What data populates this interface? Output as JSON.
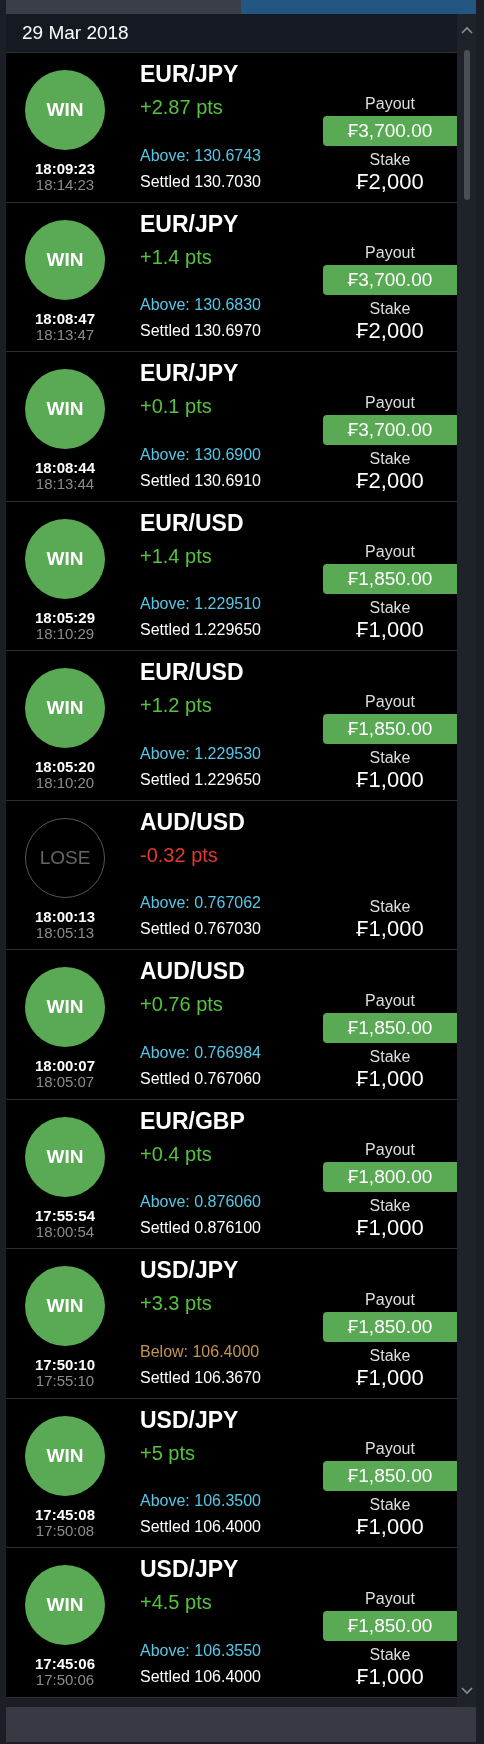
{
  "tabs": [
    {
      "selected": false
    },
    {
      "selected": true
    }
  ],
  "date_header": "29 Mar 2018",
  "trades": [
    {
      "kind": "win",
      "result_label": "WIN",
      "pair": "EUR/JPY",
      "points": "+2.87 pts",
      "below": false,
      "strike": "Above: 130.6743",
      "settled": "Settled 130.7030",
      "open_time": "18:09:23",
      "close_time": "18:14:23",
      "payout_label": "Payout",
      "payout": "₣3,700.00",
      "stake_label": "Stake",
      "stake": "₣2,000"
    },
    {
      "kind": "win",
      "result_label": "WIN",
      "pair": "EUR/JPY",
      "points": "+1.4 pts",
      "below": false,
      "strike": "Above: 130.6830",
      "settled": "Settled 130.6970",
      "open_time": "18:08:47",
      "close_time": "18:13:47",
      "payout_label": "Payout",
      "payout": "₣3,700.00",
      "stake_label": "Stake",
      "stake": "₣2,000"
    },
    {
      "kind": "win",
      "result_label": "WIN",
      "pair": "EUR/JPY",
      "points": "+0.1 pts",
      "below": false,
      "strike": "Above: 130.6900",
      "settled": "Settled 130.6910",
      "open_time": "18:08:44",
      "close_time": "18:13:44",
      "payout_label": "Payout",
      "payout": "₣3,700.00",
      "stake_label": "Stake",
      "stake": "₣2,000"
    },
    {
      "kind": "win",
      "result_label": "WIN",
      "pair": "EUR/USD",
      "points": "+1.4 pts",
      "below": false,
      "strike": "Above: 1.229510",
      "settled": "Settled 1.229650",
      "open_time": "18:05:29",
      "close_time": "18:10:29",
      "payout_label": "Payout",
      "payout": "₣1,850.00",
      "stake_label": "Stake",
      "stake": "₣1,000"
    },
    {
      "kind": "win",
      "result_label": "WIN",
      "pair": "EUR/USD",
      "points": "+1.2 pts",
      "below": false,
      "strike": "Above: 1.229530",
      "settled": "Settled 1.229650",
      "open_time": "18:05:20",
      "close_time": "18:10:20",
      "payout_label": "Payout",
      "payout": "₣1,850.00",
      "stake_label": "Stake",
      "stake": "₣1,000"
    },
    {
      "kind": "lose",
      "result_label": "LOSE",
      "pair": "AUD/USD",
      "points": "-0.32 pts",
      "below": false,
      "strike": "Above: 0.767062",
      "settled": "Settled 0.767030",
      "open_time": "18:00:13",
      "close_time": "18:05:13",
      "stake_label": "Stake",
      "stake": "₣1,000"
    },
    {
      "kind": "win",
      "result_label": "WIN",
      "pair": "AUD/USD",
      "points": "+0.76 pts",
      "below": false,
      "strike": "Above: 0.766984",
      "settled": "Settled 0.767060",
      "open_time": "18:00:07",
      "close_time": "18:05:07",
      "payout_label": "Payout",
      "payout": "₣1,850.00",
      "stake_label": "Stake",
      "stake": "₣1,000"
    },
    {
      "kind": "win",
      "result_label": "WIN",
      "pair": "EUR/GBP",
      "points": "+0.4 pts",
      "below": false,
      "strike": "Above: 0.876060",
      "settled": "Settled 0.876100",
      "open_time": "17:55:54",
      "close_time": "18:00:54",
      "payout_label": "Payout",
      "payout": "₣1,800.00",
      "stake_label": "Stake",
      "stake": "₣1,000"
    },
    {
      "kind": "win",
      "result_label": "WIN",
      "pair": "USD/JPY",
      "points": "+3.3 pts",
      "below": true,
      "strike": "Below: 106.4000",
      "settled": "Settled 106.3670",
      "open_time": "17:50:10",
      "close_time": "17:55:10",
      "payout_label": "Payout",
      "payout": "₣1,850.00",
      "stake_label": "Stake",
      "stake": "₣1,000"
    },
    {
      "kind": "win",
      "result_label": "WIN",
      "pair": "USD/JPY",
      "points": "+5 pts",
      "below": false,
      "strike": "Above: 106.3500",
      "settled": "Settled 106.4000",
      "open_time": "17:45:08",
      "close_time": "17:50:08",
      "payout_label": "Payout",
      "payout": "₣1,850.00",
      "stake_label": "Stake",
      "stake": "₣1,000"
    },
    {
      "kind": "win",
      "result_label": "WIN",
      "pair": "USD/JPY",
      "points": "+4.5 pts",
      "below": false,
      "strike": "Above: 106.3550",
      "settled": "Settled 106.4000",
      "open_time": "17:45:06",
      "close_time": "17:50:06",
      "payout_label": "Payout",
      "payout": "₣1,850.00",
      "stake_label": "Stake",
      "stake": "₣1,000"
    }
  ]
}
